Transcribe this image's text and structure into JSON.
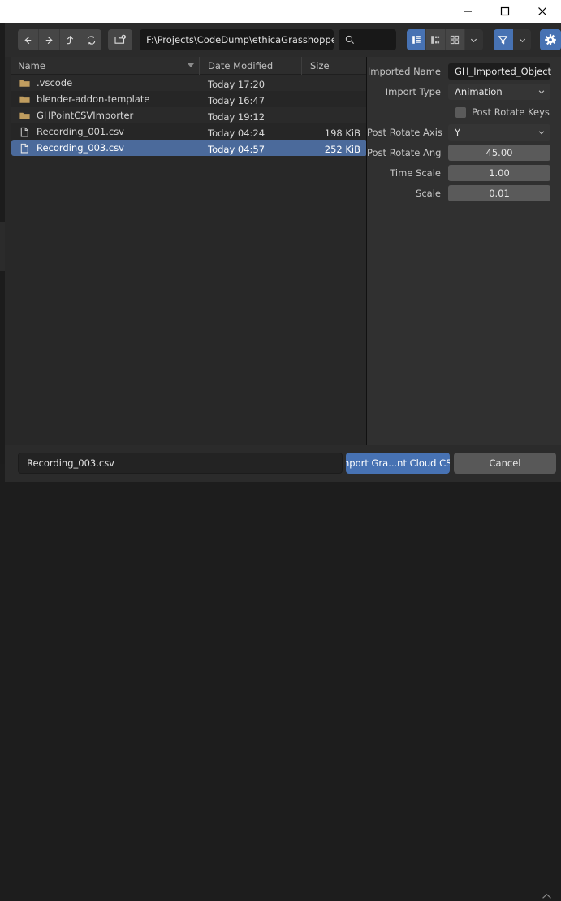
{
  "window": {
    "controls": [
      {
        "name": "minimize",
        "glyph": "minimize-icon"
      },
      {
        "name": "maximize",
        "glyph": "maximize-icon"
      },
      {
        "name": "close",
        "glyph": "close-icon"
      }
    ]
  },
  "header": {
    "nav": [
      {
        "name": "back",
        "icon": "arrow-left-icon"
      },
      {
        "name": "forward",
        "icon": "arrow-right-icon"
      },
      {
        "name": "parent",
        "icon": "arrow-up-icon"
      },
      {
        "name": "refresh",
        "icon": "refresh-icon"
      }
    ],
    "new_folder_icon": "new-folder-icon",
    "path": "F:\\Projects\\CodeDump\\ethicaGrasshopperPa...",
    "search_placeholder": "",
    "search_value": "",
    "search_icon": "search-icon",
    "display_modes": [
      {
        "name": "vertical-list",
        "active": true
      },
      {
        "name": "horizontal-list",
        "active": false
      },
      {
        "name": "thumbnails",
        "active": false
      }
    ],
    "display_chevron": "chevron-down-icon",
    "filter_icon": "funnel-icon",
    "filter_chevron": "chevron-down-icon",
    "settings_icon": "gear-icon"
  },
  "filelist": {
    "columns": [
      {
        "key": "name",
        "label": "Name",
        "sorted": true,
        "sort_dir": "desc"
      },
      {
        "key": "date",
        "label": "Date Modified"
      },
      {
        "key": "size",
        "label": "Size"
      }
    ],
    "rows": [
      {
        "icon": "folder-icon",
        "name": ".vscode",
        "date": "Today 17:20",
        "size": "",
        "selected": false
      },
      {
        "icon": "folder-icon",
        "name": "blender-addon-template",
        "date": "Today 16:47",
        "size": "",
        "selected": false
      },
      {
        "icon": "folder-icon",
        "name": "GHPointCSVImporter",
        "date": "Today 19:12",
        "size": "",
        "selected": false
      },
      {
        "icon": "file-icon",
        "name": "Recording_001.csv",
        "date": "Today 04:24",
        "size": "198 KiB",
        "selected": false
      },
      {
        "icon": "file-icon",
        "name": "Recording_003.csv",
        "date": "Today 04:57",
        "size": "252 KiB",
        "selected": true
      }
    ]
  },
  "properties": {
    "fields": [
      {
        "label": "Imported Name",
        "value": "GH_Imported_Object",
        "kind": "text"
      },
      {
        "label": "Import Type",
        "value": "Animation",
        "kind": "dropdown"
      }
    ],
    "checkbox": {
      "label": "Post Rotate Keys",
      "checked": false
    },
    "fields2": [
      {
        "label": "Post Rotate Axis",
        "value": "Y",
        "kind": "dropdown"
      },
      {
        "label": "Post Rotate Ang",
        "value": "45.00",
        "kind": "value"
      },
      {
        "label": "Time Scale",
        "value": "1.00",
        "kind": "value"
      },
      {
        "label": "Scale",
        "value": "0.01",
        "kind": "value"
      }
    ]
  },
  "bottom": {
    "filename": "Recording_003.csv",
    "import_label": "Import Gra...nt Cloud CSV",
    "cancel_label": "Cancel",
    "collapse_icon": "chevron-up-icon"
  },
  "colors": {
    "accent": "#4772b3",
    "selection": "#4b6a9b",
    "folder": "#c09d5f",
    "panel": "#303030",
    "list_bg": "#282828"
  }
}
